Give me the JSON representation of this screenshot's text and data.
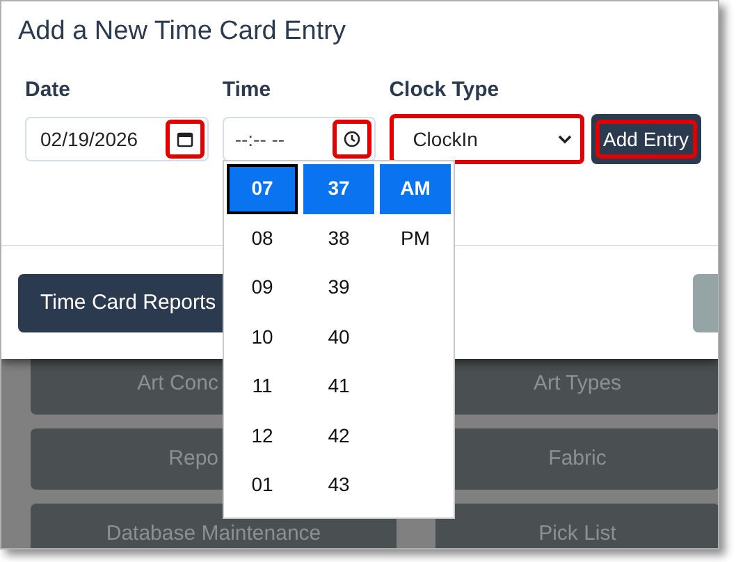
{
  "modal": {
    "title": "Add a New Time Card Entry",
    "date": {
      "label": "Date",
      "value": "02/19/2026",
      "picker_highlighted": true
    },
    "time": {
      "label": "Time",
      "placeholder": "--:-- --",
      "picker_highlighted": true
    },
    "clock_type": {
      "label": "Clock Type",
      "value": "ClockIn",
      "highlighted": true
    },
    "add_button": {
      "label": "Add Entry",
      "highlighted": true
    },
    "footer_buttons": [
      {
        "label": "Time Card Reports",
        "kind": "primary"
      },
      {
        "kind": "secondary"
      }
    ]
  },
  "time_picker": {
    "columns": [
      [
        {
          "label": "07",
          "selected": true
        },
        {
          "label": "08",
          "selected": false
        },
        {
          "label": "09",
          "selected": false
        },
        {
          "label": "10",
          "selected": false
        },
        {
          "label": "11",
          "selected": false
        },
        {
          "label": "12",
          "selected": false
        },
        {
          "label": "01",
          "selected": false
        }
      ],
      [
        {
          "label": "37",
          "selected": true
        },
        {
          "label": "38",
          "selected": false
        },
        {
          "label": "39",
          "selected": false
        },
        {
          "label": "40",
          "selected": false
        },
        {
          "label": "41",
          "selected": false
        },
        {
          "label": "42",
          "selected": false
        },
        {
          "label": "43",
          "selected": false
        }
      ],
      [
        {
          "label": "AM",
          "selected": true
        },
        {
          "label": "PM",
          "selected": false
        }
      ]
    ]
  },
  "background_tiles": [
    {
      "label": "Art Conc",
      "cut": true
    },
    {
      "label": "Art Types",
      "cut": false
    },
    {
      "label": "Repo",
      "cut": true
    },
    {
      "label": "Fabric",
      "cut": false
    },
    {
      "label": "Database Maintenance",
      "cut": false
    },
    {
      "label": "Pick List",
      "cut": false
    }
  ]
}
